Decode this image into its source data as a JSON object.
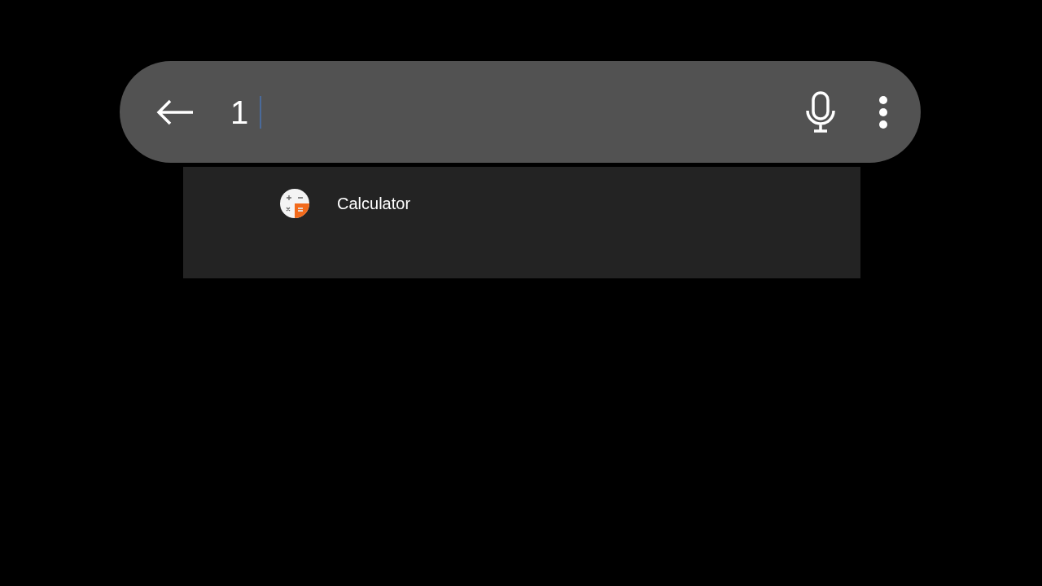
{
  "search": {
    "value": "1"
  },
  "results": [
    {
      "label": "Calculator"
    }
  ]
}
